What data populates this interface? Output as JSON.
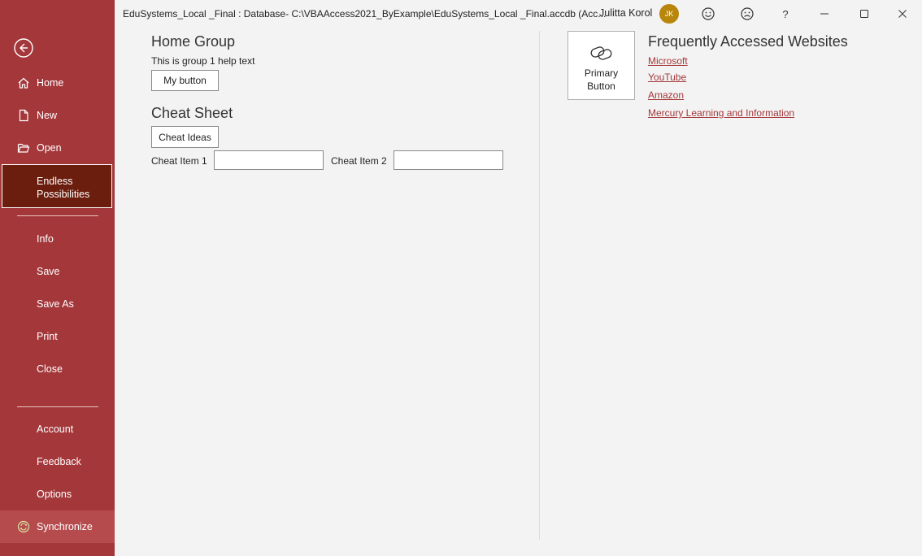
{
  "window": {
    "title": "EduSystems_Local _Final : Database- C:\\VBAAccess2021_ByExample\\EduSystems_Local _Final.accdb (Acc...",
    "user_name": "Julitta Korol",
    "user_initials": "JK"
  },
  "sidebar": {
    "back_icon": "back-arrow-icon",
    "items_top": [
      {
        "label": "Home",
        "icon": "home-icon"
      },
      {
        "label": "New",
        "icon": "new-doc-icon"
      },
      {
        "label": "Open",
        "icon": "folder-open-icon"
      }
    ],
    "selected": {
      "line1": "Endless",
      "line2": "Possibilities"
    },
    "items_mid": [
      {
        "label": "Info"
      },
      {
        "label": "Save"
      },
      {
        "label": "Save As"
      },
      {
        "label": "Print"
      },
      {
        "label": "Close"
      }
    ],
    "items_bottom": [
      {
        "label": "Account"
      },
      {
        "label": "Feedback"
      },
      {
        "label": "Options"
      }
    ],
    "sync": {
      "label": "Synchronize",
      "icon": "sync-icon"
    }
  },
  "home_group": {
    "title": "Home Group",
    "help_text": "This is group 1 help text",
    "button_label": "My button"
  },
  "cheat_sheet": {
    "title": "Cheat Sheet",
    "button_label": "Cheat Ideas",
    "item1_label": "Cheat Item 1",
    "item1_value": "",
    "item2_label": "Cheat Item 2",
    "item2_value": ""
  },
  "primary_button": {
    "label": "Primary Button",
    "icon": "link-icon"
  },
  "websites": {
    "title": "Frequently Accessed Websites",
    "links": [
      "Microsoft",
      "YouTube",
      "Amazon",
      "Mercury Learning and Information"
    ]
  },
  "colors": {
    "accent": "#a4373a",
    "selected": "#6b1e0e",
    "avatar": "#b8860b"
  }
}
